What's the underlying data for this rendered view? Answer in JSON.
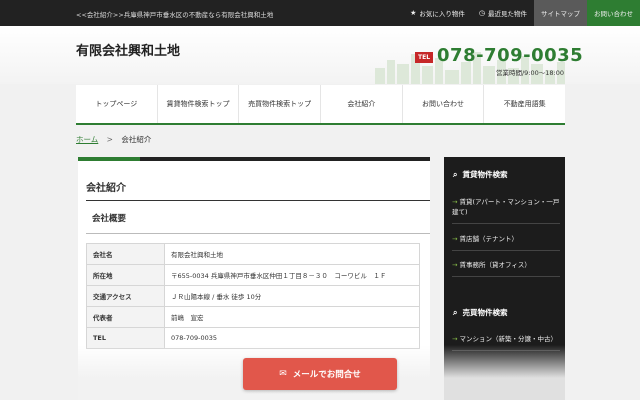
{
  "topbar": {
    "tagline": "<<会社紹介>>兵庫県神戸市垂水区の不動産なら有限会社興和土地",
    "links": [
      {
        "label": "お気に入り物件",
        "icon": "star-icon"
      },
      {
        "label": "最近見た物件",
        "icon": "clock-icon"
      },
      {
        "label": "サイトマップ"
      },
      {
        "label": "お問い合わせ"
      }
    ]
  },
  "header": {
    "company": "有限会社興和土地",
    "tel_badge": "TEL",
    "phone": "078-709-0035",
    "hours": "営業時間/9:00～18:00"
  },
  "nav": [
    "トップページ",
    "賃貸物件検索トップ",
    "売買物件検索トップ",
    "会社紹介",
    "お問い合わせ",
    "不動産用語集"
  ],
  "breadcrumb": {
    "home": "ホーム",
    "separator": ">",
    "current": "会社紹介"
  },
  "main": {
    "title": "会社紹介",
    "section": "会社概要",
    "rows": [
      {
        "key": "会社名",
        "value": "有限会社興和土地"
      },
      {
        "key": "所在地",
        "value": "〒655-0034 兵庫県神戸市垂水区仲田１丁目８－３０　コーワビル　１Ｆ"
      },
      {
        "key": "交通アクセス",
        "value": "ＪＲ山陽本線 / 垂水 徒歩 10分"
      },
      {
        "key": "代表者",
        "value": "前嶋　宣宏"
      },
      {
        "key": "TEL",
        "value": "078-709-0035"
      }
    ]
  },
  "sidebar": {
    "rental_heading": "賃貸物件検索",
    "rental_items": [
      "賃貸(アパート・マンション・一戸建て)",
      "賃店舗（テナント）",
      "賃事務所（貸オフィス）"
    ],
    "sale_heading": "売買物件検索",
    "sale_items": [
      "マンション（新築・分譲・中古）"
    ]
  },
  "cta": {
    "mail_label": "メールでお問合せ",
    "icon": "mail-icon"
  },
  "colors": {
    "accent_green": "#2e7d32",
    "dark": "#222222",
    "cta_red": "#e1574b"
  }
}
